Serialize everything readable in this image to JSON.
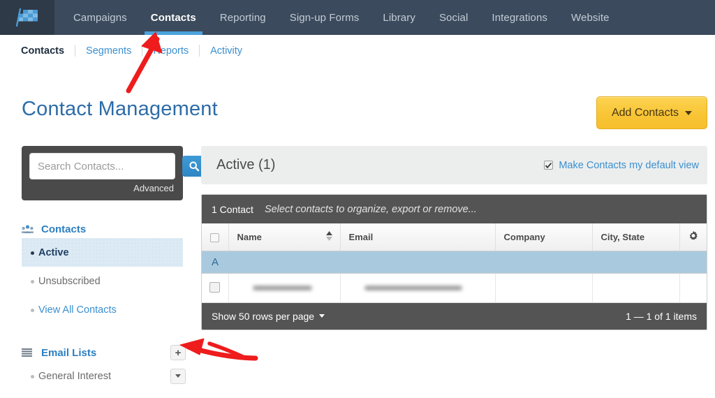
{
  "topnav": {
    "logo_icon": "checkered-flag-logo",
    "items": [
      {
        "label": "Campaigns",
        "active": false
      },
      {
        "label": "Contacts",
        "active": true
      },
      {
        "label": "Reporting",
        "active": false
      },
      {
        "label": "Sign-up Forms",
        "active": false
      },
      {
        "label": "Library",
        "active": false
      },
      {
        "label": "Social",
        "active": false
      },
      {
        "label": "Integrations",
        "active": false
      },
      {
        "label": "Website",
        "active": false
      }
    ]
  },
  "subnav": {
    "items": [
      {
        "label": "Contacts",
        "current": true
      },
      {
        "label": "Segments",
        "current": false
      },
      {
        "label": "Reports",
        "current": false
      },
      {
        "label": "Activity",
        "current": false
      }
    ]
  },
  "header": {
    "title": "Contact Management",
    "add_contacts_label": "Add Contacts"
  },
  "sidebar": {
    "search": {
      "placeholder": "Search Contacts...",
      "value": "",
      "icon": "search-icon",
      "advanced_label": "Advanced"
    },
    "contacts_group": {
      "label": "Contacts",
      "icon": "contacts-group-icon",
      "items": [
        {
          "label": "Active",
          "selected": true
        },
        {
          "label": "Unsubscribed",
          "selected": false
        },
        {
          "label": "View All Contacts",
          "selected": false
        }
      ]
    },
    "email_lists_group": {
      "label": "Email Lists",
      "icon": "list-icon",
      "add_button_label": "+",
      "items": [
        {
          "label": "General Interest",
          "selected": false
        }
      ]
    }
  },
  "main": {
    "panel_title": "Active (1)",
    "default_view_label": "Make Contacts my default view",
    "default_view_checked": true,
    "toolbar": {
      "count_label": "1 Contact",
      "hint": "Select contacts to organize, export or remove..."
    },
    "table": {
      "columns": [
        "Name",
        "Email",
        "Company",
        "City, State"
      ],
      "gear_icon": "gear-icon",
      "sort_icon": "sort-arrows-icon",
      "alpha_group": "A",
      "rows": [
        {
          "name": "",
          "email": "",
          "company": "",
          "city_state": "",
          "redacted": true
        }
      ]
    },
    "footer": {
      "rows_per_page_label": "Show 50 rows per page",
      "page_range": "1 — 1 of 1 items"
    }
  },
  "annotations": {
    "arrow_1": "red-arrow-pointing-to-contacts-tab",
    "arrow_2": "red-arrow-pointing-to-add-email-list-button",
    "color": "#ee1c1c"
  },
  "colors": {
    "nav_bg": "#3b4a5c",
    "logo_bg": "#2e3a48",
    "accent_blue": "#3a8fd0",
    "active_underline": "#4aa3dd",
    "button_yellow": "#f8c536",
    "toolbar_dark": "#545454",
    "alpha_row": "#a9cade",
    "selected_sidebar": "#dceaf4"
  }
}
